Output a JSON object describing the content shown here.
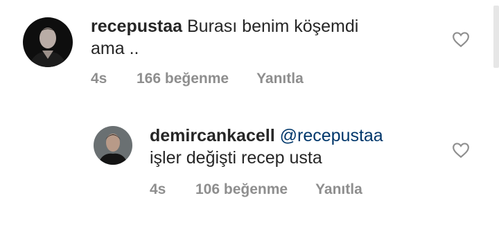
{
  "comments": [
    {
      "username": "recepustaa",
      "text_line1": "Burası benim köşemdi",
      "text_line2": "ama ..",
      "time": "4s",
      "likes": "166 beğenme",
      "reply_label": "Yanıtla",
      "avatar_icon": "profile-photo"
    },
    {
      "username": "demircankacell",
      "mention": "@recepustaa",
      "text_line2": "işler değişti recep usta",
      "time": "4s",
      "likes": "106 beğenme",
      "reply_label": "Yanıtla",
      "avatar_icon": "profile-photo"
    }
  ],
  "icons": {
    "like": "heart-outline-icon"
  },
  "colors": {
    "text": "#262626",
    "secondary": "#8e8e8e",
    "mention": "#00376b"
  }
}
